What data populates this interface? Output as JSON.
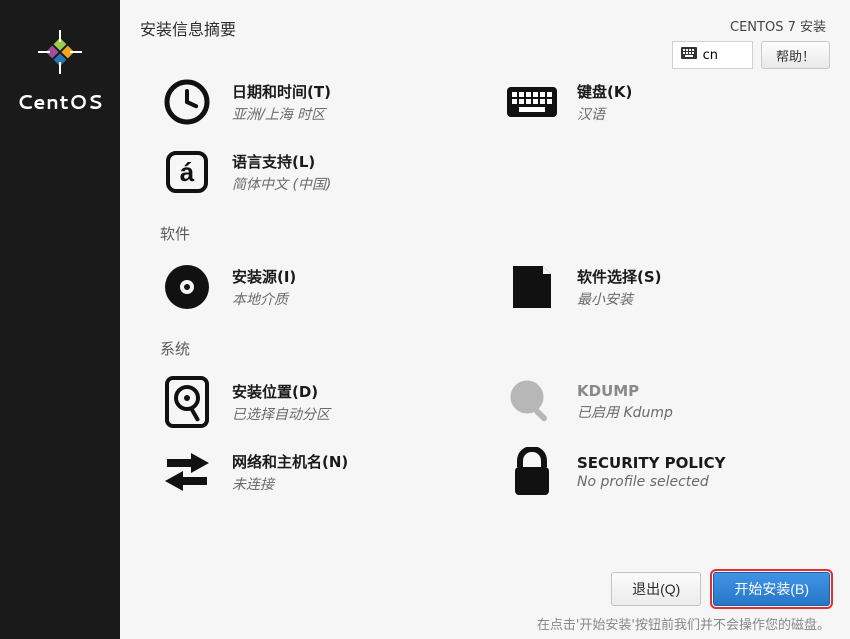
{
  "sidebar": {
    "brand": "CentOS"
  },
  "header": {
    "title": "安装信息摘要",
    "product": "CENTOS 7 安装",
    "keyboard": "cn",
    "help": "帮助！"
  },
  "categories": {
    "localization": {
      "datetime": {
        "title": "日期和时间(T)",
        "status": "亚洲/上海 时区"
      },
      "keyboard": {
        "title": "键盘(K)",
        "status": "汉语"
      },
      "language": {
        "title": "语言支持(L)",
        "status": "简体中文 (中国)"
      }
    },
    "software": {
      "label": "软件",
      "source": {
        "title": "安装源(I)",
        "status": "本地介质"
      },
      "selection": {
        "title": "软件选择(S)",
        "status": "最小安装"
      }
    },
    "system": {
      "label": "系统",
      "destination": {
        "title": "安装位置(D)",
        "status": "已选择自动分区"
      },
      "kdump": {
        "title": "KDUMP",
        "status": "已启用 Kdump"
      },
      "network": {
        "title": "网络和主机名(N)",
        "status": "未连接"
      },
      "security": {
        "title": "SECURITY POLICY",
        "status": "No profile selected"
      }
    }
  },
  "footer": {
    "quit": "退出(Q)",
    "begin": "开始安装(B)",
    "hint": "在点击'开始安装'按钮前我们并不会操作您的磁盘。"
  }
}
